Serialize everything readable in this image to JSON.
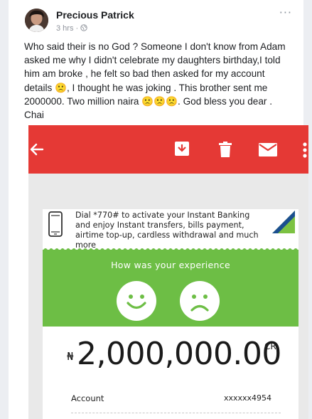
{
  "post": {
    "author": "Precious Patrick",
    "time": "3 hrs",
    "separator": "·",
    "privacy_icon": "public-globe-icon",
    "more": "···",
    "lines": [
      "Who said their is no God ? Someone I don't know from Adam",
      "asked me why I didn't celebrate my daughters birthday,I told",
      "him am broke , he felt so bad then asked for my account",
      "details 🙁, I thought he was joking . This brother sent me",
      "2000000. Two million naira 🙁🙁🙁. God bless you dear .",
      "Chai"
    ]
  },
  "screenshot": {
    "toolbar_icons": [
      "back-arrow-icon",
      "archive-icon",
      "delete-icon",
      "mail-icon",
      "more-vert-icon"
    ],
    "banner": {
      "line1": "Dial *770# to activate your Instant Banking",
      "line2": "and enjoy Instant transfers, bills payment,",
      "line3": "airtime top-up, cardless withdrawal and much more"
    },
    "survey": {
      "title": "How was your experience",
      "happy_icon": "happy-face-icon",
      "sad_icon": "sad-face-icon"
    },
    "amount": {
      "currency": "₦",
      "value": "2,000,000.00",
      "suffix": "CR"
    },
    "account": {
      "label": "Account",
      "value": "xxxxxx4954"
    }
  },
  "colors": {
    "toolbar_red": "#e53935",
    "survey_green": "#6dbe45",
    "brand_blue": "#1b4f8f",
    "brand_green": "#7cc242"
  }
}
